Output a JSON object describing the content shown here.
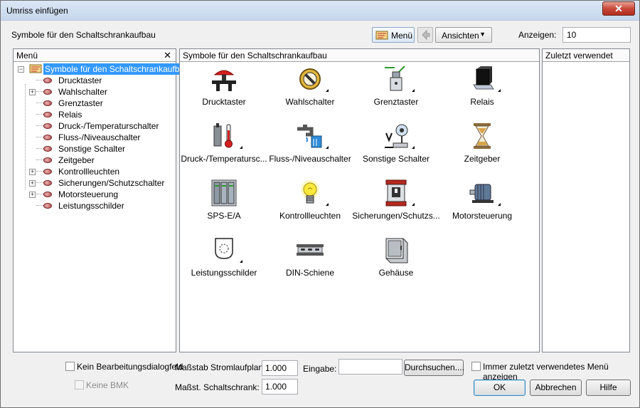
{
  "window": {
    "title": "Umriss einfügen",
    "close_label": "✕"
  },
  "toolbar": {
    "heading": "Symbole für den Schaltschrankaufbau",
    "menu_label": "Menü",
    "views_label": "Ansichten",
    "show_label": "Anzeigen:",
    "show_value": "10"
  },
  "menu_panel": {
    "title": "Menü",
    "close_label": "✕",
    "root": "Symbole für den Schaltschrankaufbau",
    "items": [
      {
        "label": "Drucktaster",
        "expandable": false
      },
      {
        "label": "Wahlschalter",
        "expandable": true
      },
      {
        "label": "Grenztaster",
        "expandable": false
      },
      {
        "label": "Relais",
        "expandable": false
      },
      {
        "label": "Druck-/Temperaturschalter",
        "expandable": false
      },
      {
        "label": "Fluss-/Niveauschalter",
        "expandable": false
      },
      {
        "label": "Sonstige Schalter",
        "expandable": false
      },
      {
        "label": "Zeitgeber",
        "expandable": false
      },
      {
        "label": "Kontrollleuchten",
        "expandable": true
      },
      {
        "label": "Sicherungen/Schutzschalter",
        "expandable": true
      },
      {
        "label": "Motorsteuerung",
        "expandable": true
      },
      {
        "label": "Leistungsschilder",
        "expandable": false
      }
    ]
  },
  "symbols_panel": {
    "title": "Symbole für den Schaltschrankaufbau",
    "symbols": [
      {
        "label": "Drucktaster",
        "icon": "pushbutton-icon"
      },
      {
        "label": "Wahlschalter",
        "icon": "selector-switch-icon"
      },
      {
        "label": "Grenztaster",
        "icon": "limit-switch-icon"
      },
      {
        "label": "Relais",
        "icon": "relay-icon"
      },
      {
        "label": "Druck-/Temperatursc...",
        "icon": "pressure-temperature-switch-icon"
      },
      {
        "label": "Fluss-/Niveauschalter",
        "icon": "flow-level-switch-icon"
      },
      {
        "label": "Sonstige Schalter",
        "icon": "other-switches-icon"
      },
      {
        "label": "Zeitgeber",
        "icon": "timer-icon"
      },
      {
        "label": "SPS-E/A",
        "icon": "plc-io-icon"
      },
      {
        "label": "Kontrollleuchten",
        "icon": "pilot-light-icon"
      },
      {
        "label": "Sicherungen/Schutzs...",
        "icon": "fuse-breaker-icon"
      },
      {
        "label": "Motorsteuerung",
        "icon": "motor-control-icon"
      },
      {
        "label": "Leistungsschilder",
        "icon": "nameplate-icon"
      },
      {
        "label": "DIN-Schiene",
        "icon": "din-rail-icon"
      },
      {
        "label": "Gehäuse",
        "icon": "enclosure-icon"
      }
    ]
  },
  "recent_panel": {
    "title": "Zuletzt verwendet"
  },
  "bottom": {
    "no_edit_dialog": "Kein Bearbeitungsdialogfeld",
    "no_bmk": "Keine BMK",
    "scale_schematic_label": "Maßstab Stromlaufplan:",
    "scale_schematic_value": "1.000",
    "scale_cabinet_label": "Maßst. Schaltschrank:",
    "scale_cabinet_value": "1.000",
    "input_label": "Eingabe:",
    "input_value": "",
    "browse_label": "Durchsuchen....",
    "always_recent_label": "Immer zuletzt verwendetes Menü anzeigen",
    "ok_label": "OK",
    "cancel_label": "Abbrechen",
    "help_label": "Hilfe"
  }
}
